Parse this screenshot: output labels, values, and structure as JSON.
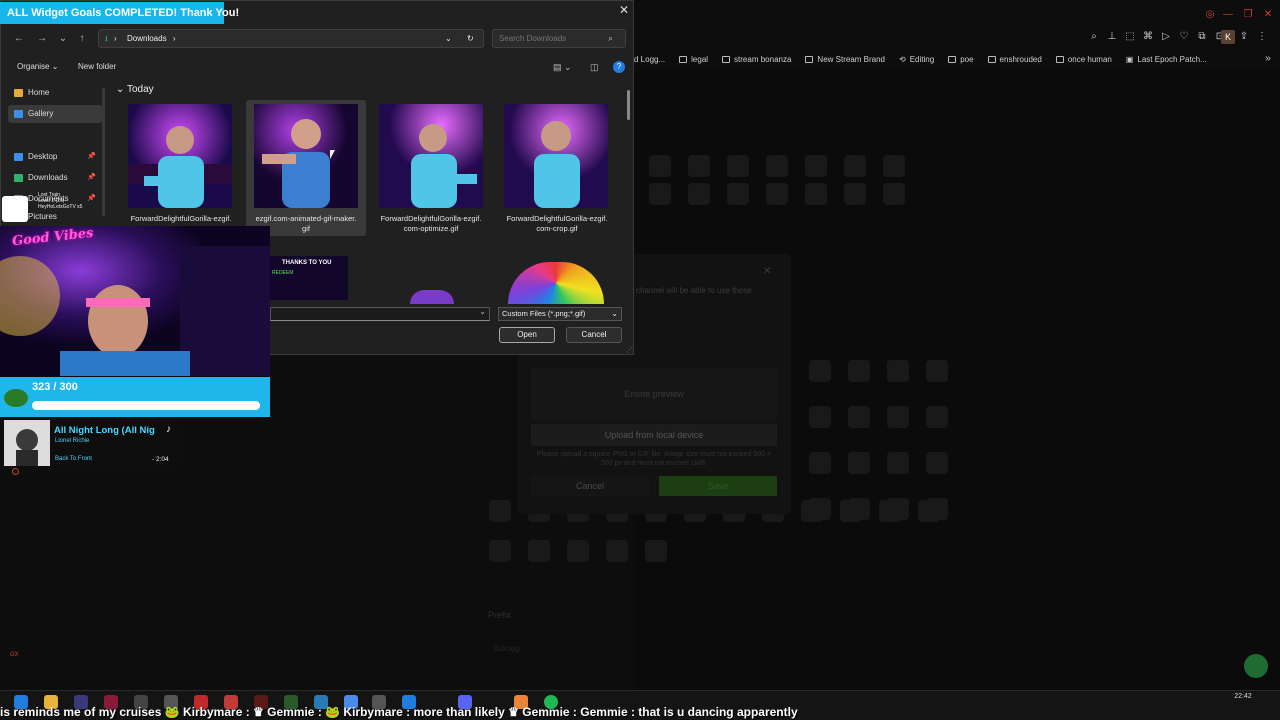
{
  "overlay": {
    "goal_banner": "ALL Widget Goals COMPLETED! Thank You!",
    "good_vibes": "Good Vibes",
    "mini_list": [
      "Lost Train",
      "Level 1 (26)",
      "HeyHoLetsGoTV x5"
    ],
    "progress_text": "323 / 300",
    "progress_fraction": 1.0,
    "music": {
      "title": "All Night Long (All Nig",
      "artist": "Lionel Richie",
      "back_label": "Back To Front",
      "time": "- 2:04"
    }
  },
  "dialog": {
    "breadcrumb": "Downloads",
    "search_placeholder": "Search Downloads",
    "organise": "Organise",
    "new_folder": "New folder",
    "nav_items": [
      {
        "label": "Home",
        "color": "#e8a93b"
      },
      {
        "label": "Gallery",
        "color": "#3b8fe8"
      },
      {
        "label": "Desktop",
        "color": "#3b8fe8"
      },
      {
        "label": "Downloads",
        "color": "#2fb36b"
      },
      {
        "label": "Documents",
        "color": "#7c8fa8"
      },
      {
        "label": "Pictures",
        "color": "#3b8fe8"
      }
    ],
    "group_header": "Today",
    "files": [
      {
        "line1": "ForwardDelightfulGorilla-ezgif.",
        "line2": ""
      },
      {
        "line1": "ezgif.com-animated-gif-maker.",
        "line2": "gif"
      },
      {
        "line1": "ForwardDelightfulGorilla-ezgif.",
        "line2": "com-optimize.gif"
      },
      {
        "line1": "ForwardDelightfulGorilla-ezgif.",
        "line2": "com-crop.gif"
      }
    ],
    "filter": "Custom Files (*.png;*.gif)",
    "open": "Open",
    "cancel": "Cancel",
    "thanks_text": "THANKS TO YOU",
    "redeem_text": "REDEEM"
  },
  "browser": {
    "bookmarks": [
      "d Logg...",
      "legal",
      "stream bonanza",
      "New Stream Brand",
      "Editing",
      "poe",
      "enshrouded",
      "once human",
      "Last Epoch Patch..."
    ],
    "profile_letter": "K",
    "modal": {
      "line1": "channel will be able to use these",
      "emote_preview": "Emote preview",
      "upload": "Upload from local device",
      "hint": "Please upload a square PNG or GIF file. Image size must not exceed 500 × 500 px and must not exceed 1MB.",
      "cancel": "Cancel",
      "save": "Save"
    },
    "prefix_label": "Prefix",
    "prefix_value": "dskogg"
  },
  "taskbar": {
    "ticker": "is reminds me of my cruises 🐸 Kirbymare : ♛ Gemmie : 🐸 Kirbymare : more than likely ♛ Gemmie : Gemmie : that is u dancing apparently",
    "time": "22:42"
  }
}
